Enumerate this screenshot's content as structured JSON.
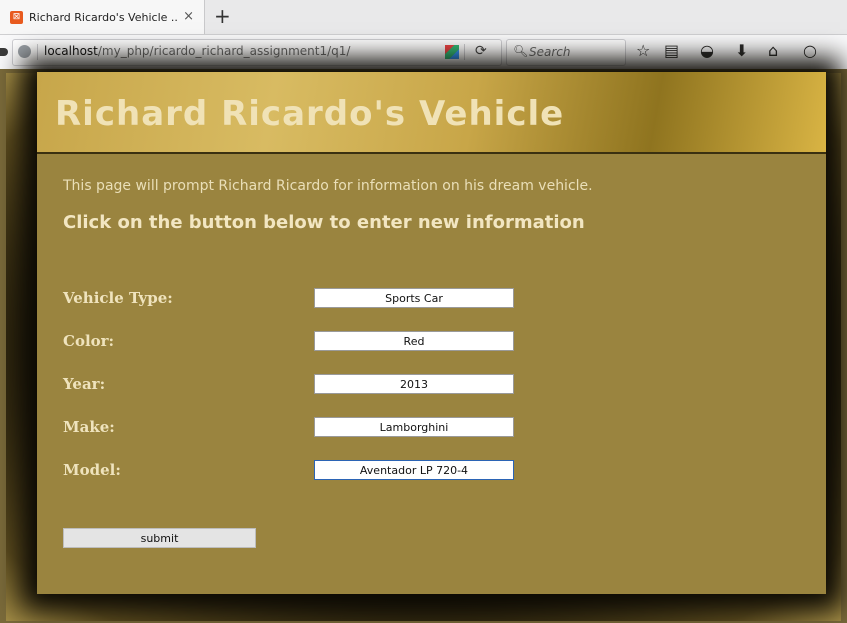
{
  "browser": {
    "tab_title": "Richard Ricardo's Vehicle ...",
    "tab_close": "×",
    "new_tab": "+",
    "url_host": "localhost",
    "url_path": "/my_php/ricardo_richard_assignment1/q1/",
    "search_placeholder": "Search",
    "reload": "⟳"
  },
  "page": {
    "banner_title": "Richard Ricardo's Vehicle",
    "intro": "This page will prompt Richard Ricardo for information on his dream vehicle.",
    "cta": "Click on the button below to enter new information"
  },
  "form": {
    "vehicle_type_label": "Vehicle Type:",
    "vehicle_type_value": "Sports Car",
    "color_label": "Color:",
    "color_value": "Red",
    "year_label": "Year:",
    "year_value": "2013",
    "make_label": "Make:",
    "make_value": "Lamborghini",
    "model_label": "Model:",
    "model_value": "Aventador LP 720-4",
    "submit_label": "submit"
  },
  "colors": {
    "card_bg": "#9a843f",
    "label_text": "#efe3bd",
    "banner_text": "#f0e2b6"
  }
}
